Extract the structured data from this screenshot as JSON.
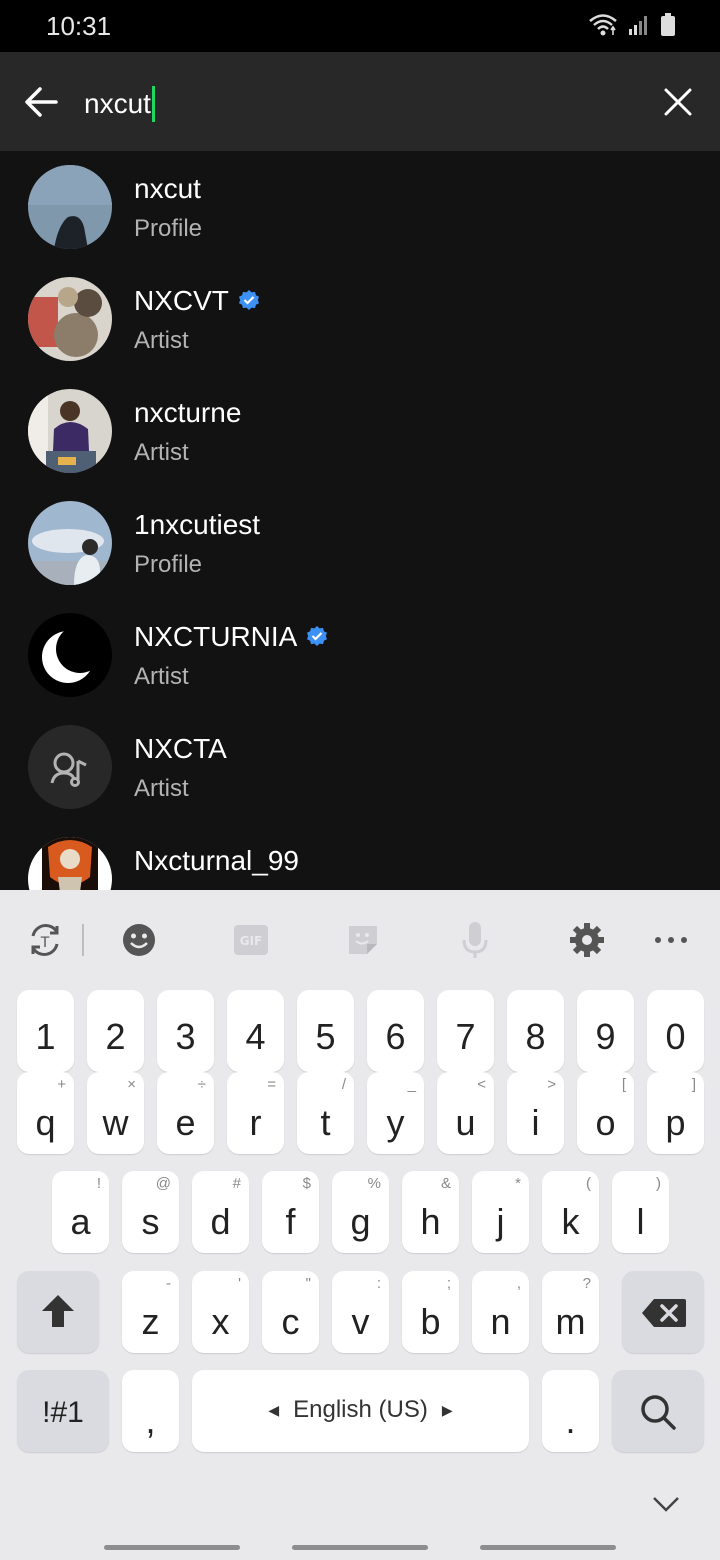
{
  "status_bar": {
    "time": "10:31"
  },
  "search": {
    "query": "nxcut"
  },
  "results": [
    {
      "name": "nxcut",
      "type": "Profile",
      "verified": false
    },
    {
      "name": "NXCVT",
      "type": "Artist",
      "verified": true
    },
    {
      "name": "nxcturne",
      "type": "Artist",
      "verified": false
    },
    {
      "name": "1nxcutiest",
      "type": "Profile",
      "verified": false
    },
    {
      "name": "NXCTURNIA",
      "type": "Artist",
      "verified": true
    },
    {
      "name": "NXCTA",
      "type": "Artist",
      "verified": false
    },
    {
      "name": "Nxcturnal_99",
      "type": "",
      "verified": false
    }
  ],
  "keyboard": {
    "numbers": [
      "1",
      "2",
      "3",
      "4",
      "5",
      "6",
      "7",
      "8",
      "9",
      "0"
    ],
    "row1": [
      {
        "k": "q",
        "a": "+"
      },
      {
        "k": "w",
        "a": "×"
      },
      {
        "k": "e",
        "a": "÷"
      },
      {
        "k": "r",
        "a": "="
      },
      {
        "k": "t",
        "a": "/"
      },
      {
        "k": "y",
        "a": "_"
      },
      {
        "k": "u",
        "a": "<"
      },
      {
        "k": "i",
        "a": ">"
      },
      {
        "k": "o",
        "a": "["
      },
      {
        "k": "p",
        "a": "]"
      }
    ],
    "row2": [
      {
        "k": "a",
        "a": "!"
      },
      {
        "k": "s",
        "a": "@"
      },
      {
        "k": "d",
        "a": "#"
      },
      {
        "k": "f",
        "a": "$"
      },
      {
        "k": "g",
        "a": "%"
      },
      {
        "k": "h",
        "a": "&"
      },
      {
        "k": "j",
        "a": "*"
      },
      {
        "k": "k",
        "a": "("
      },
      {
        "k": "l",
        "a": ")"
      }
    ],
    "row3": [
      {
        "k": "z",
        "a": "-"
      },
      {
        "k": "x",
        "a": "'"
      },
      {
        "k": "c",
        "a": "\""
      },
      {
        "k": "v",
        "a": ":"
      },
      {
        "k": "b",
        "a": ";"
      },
      {
        "k": "n",
        "a": ","
      },
      {
        "k": "m",
        "a": "?"
      }
    ],
    "symbols_label": "!#1",
    "comma": ",",
    "space_label": "English (US)",
    "period": "."
  },
  "colors": {
    "accent": "#1ed760",
    "verified": "#3d91f4",
    "bg": "#121212",
    "header": "#282828"
  }
}
